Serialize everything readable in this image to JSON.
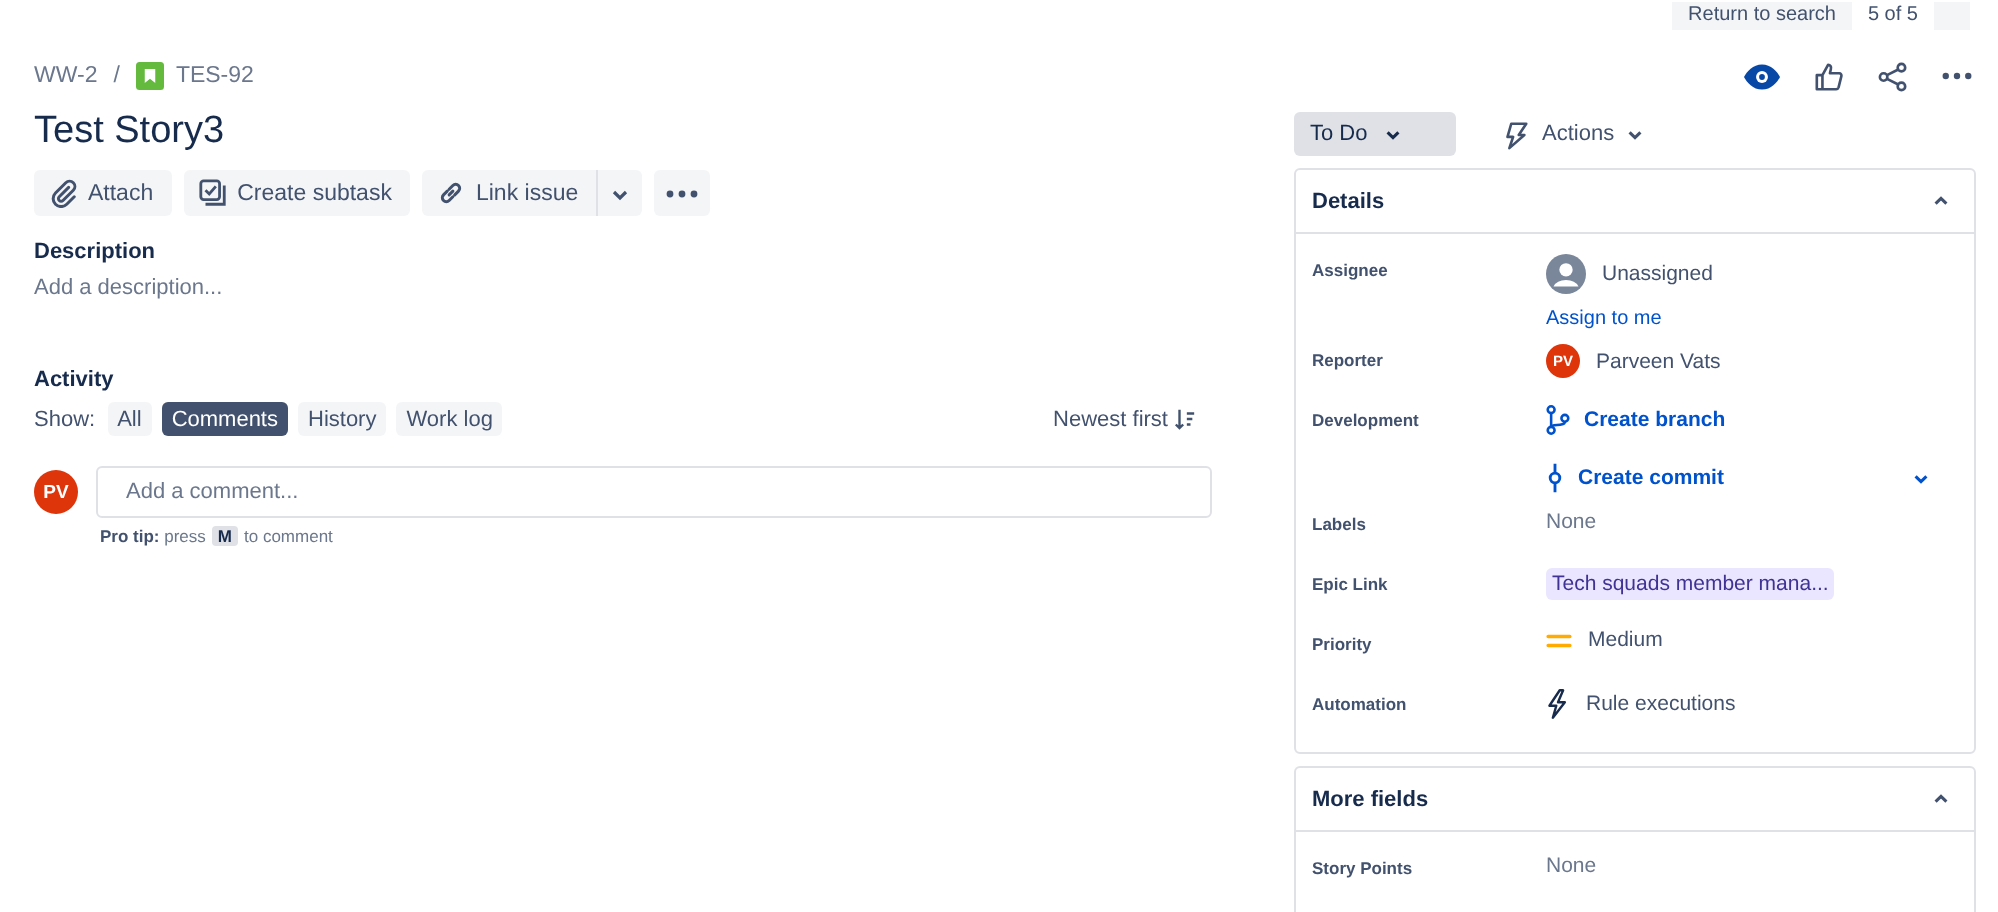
{
  "top_bar": {
    "return_button": "Return to search",
    "counter": "5 of 5"
  },
  "breadcrumb_separator": "/",
  "breadcrumbs": [
    {
      "label": "WW-2",
      "kind": "project"
    },
    {
      "label": "TES-92",
      "kind": "story"
    }
  ],
  "title": "Test Story3",
  "toolbar": [
    {
      "label": "Attach",
      "kind": "attach"
    },
    {
      "label": "Create subtask",
      "kind": "subtask"
    },
    {
      "label": "Link issue",
      "kind": "link"
    }
  ],
  "description": {
    "heading": "Description",
    "placeholder": "Add a description..."
  },
  "activity": {
    "heading": "Activity",
    "show_label": "Show:",
    "filters": [
      {
        "label": "All",
        "selected": false
      },
      {
        "label": "Comments",
        "selected": true
      },
      {
        "label": "History",
        "selected": false
      },
      {
        "label": "Work log",
        "selected": false
      }
    ],
    "sort": "Newest first",
    "comment": {
      "avatar": "PV",
      "placeholder": "Add a comment..."
    },
    "pro_tip": {
      "text": "**Pro tip:** press",
      "key": "M",
      "after": "to comment"
    }
  },
  "status": "To Do",
  "actions": "Actions",
  "details": {
    "title": "Details",
    "expanded": true,
    "fields": [
      {
        "label": "Assignee",
        "kind": "user",
        "value": "Unassigned",
        "link": "Assign to me"
      },
      {
        "label": "Reporter",
        "kind": "avatar",
        "initials": "PV",
        "value": "Parveen Vats"
      },
      {
        "label": "Development",
        "kind": "dev",
        "branch": "Create branch",
        "commit": "Create commit"
      },
      {
        "label": "Labels",
        "kind": "text",
        "value": "None"
      },
      {
        "label": "Epic Link",
        "kind": "tag",
        "value": "Tech squads member mana..."
      },
      {
        "label": "Priority",
        "kind": "priority",
        "value": "Medium"
      },
      {
        "label": "Automation",
        "kind": "automation",
        "value": "Rule executions"
      }
    ]
  },
  "more_fields": {
    "title": "More fields",
    "expanded": true,
    "fields": [
      {
        "label": "Story Points",
        "kind": "text",
        "value": "None"
      }
    ]
  }
}
